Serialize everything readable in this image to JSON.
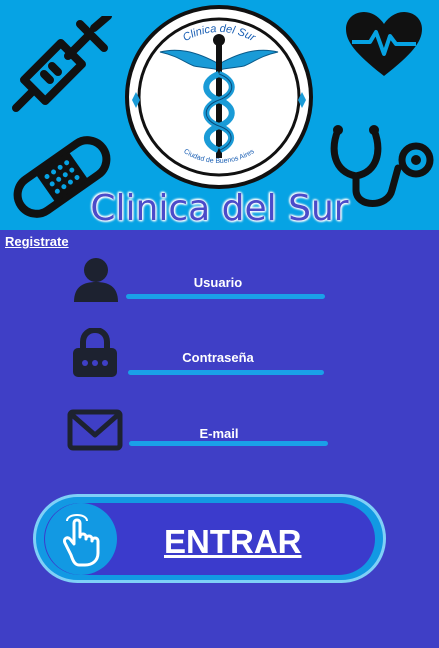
{
  "header": {
    "brand_title": "Clinica del Sur",
    "logo": {
      "top_text": "Clinica del Sur",
      "bottom_text": "Ciudad de Buenos Aires",
      "emblem": "caduceus-icon"
    },
    "icons": [
      "syringe-icon",
      "heart-pulse-icon",
      "bandage-icon",
      "stethoscope-icon"
    ]
  },
  "register_link": "Registrate",
  "fields": {
    "user_label": "Usuario",
    "password_label": "Contraseña",
    "email_label": "E-mail"
  },
  "enter_button": {
    "label": "ENTRAR",
    "icon": "hand-pointer-icon"
  },
  "colors": {
    "header_bg": "#06a3e4",
    "body_bg": "#3f3fc6",
    "accent": "#1aa0e8",
    "icon_dark": "#1d2230"
  }
}
